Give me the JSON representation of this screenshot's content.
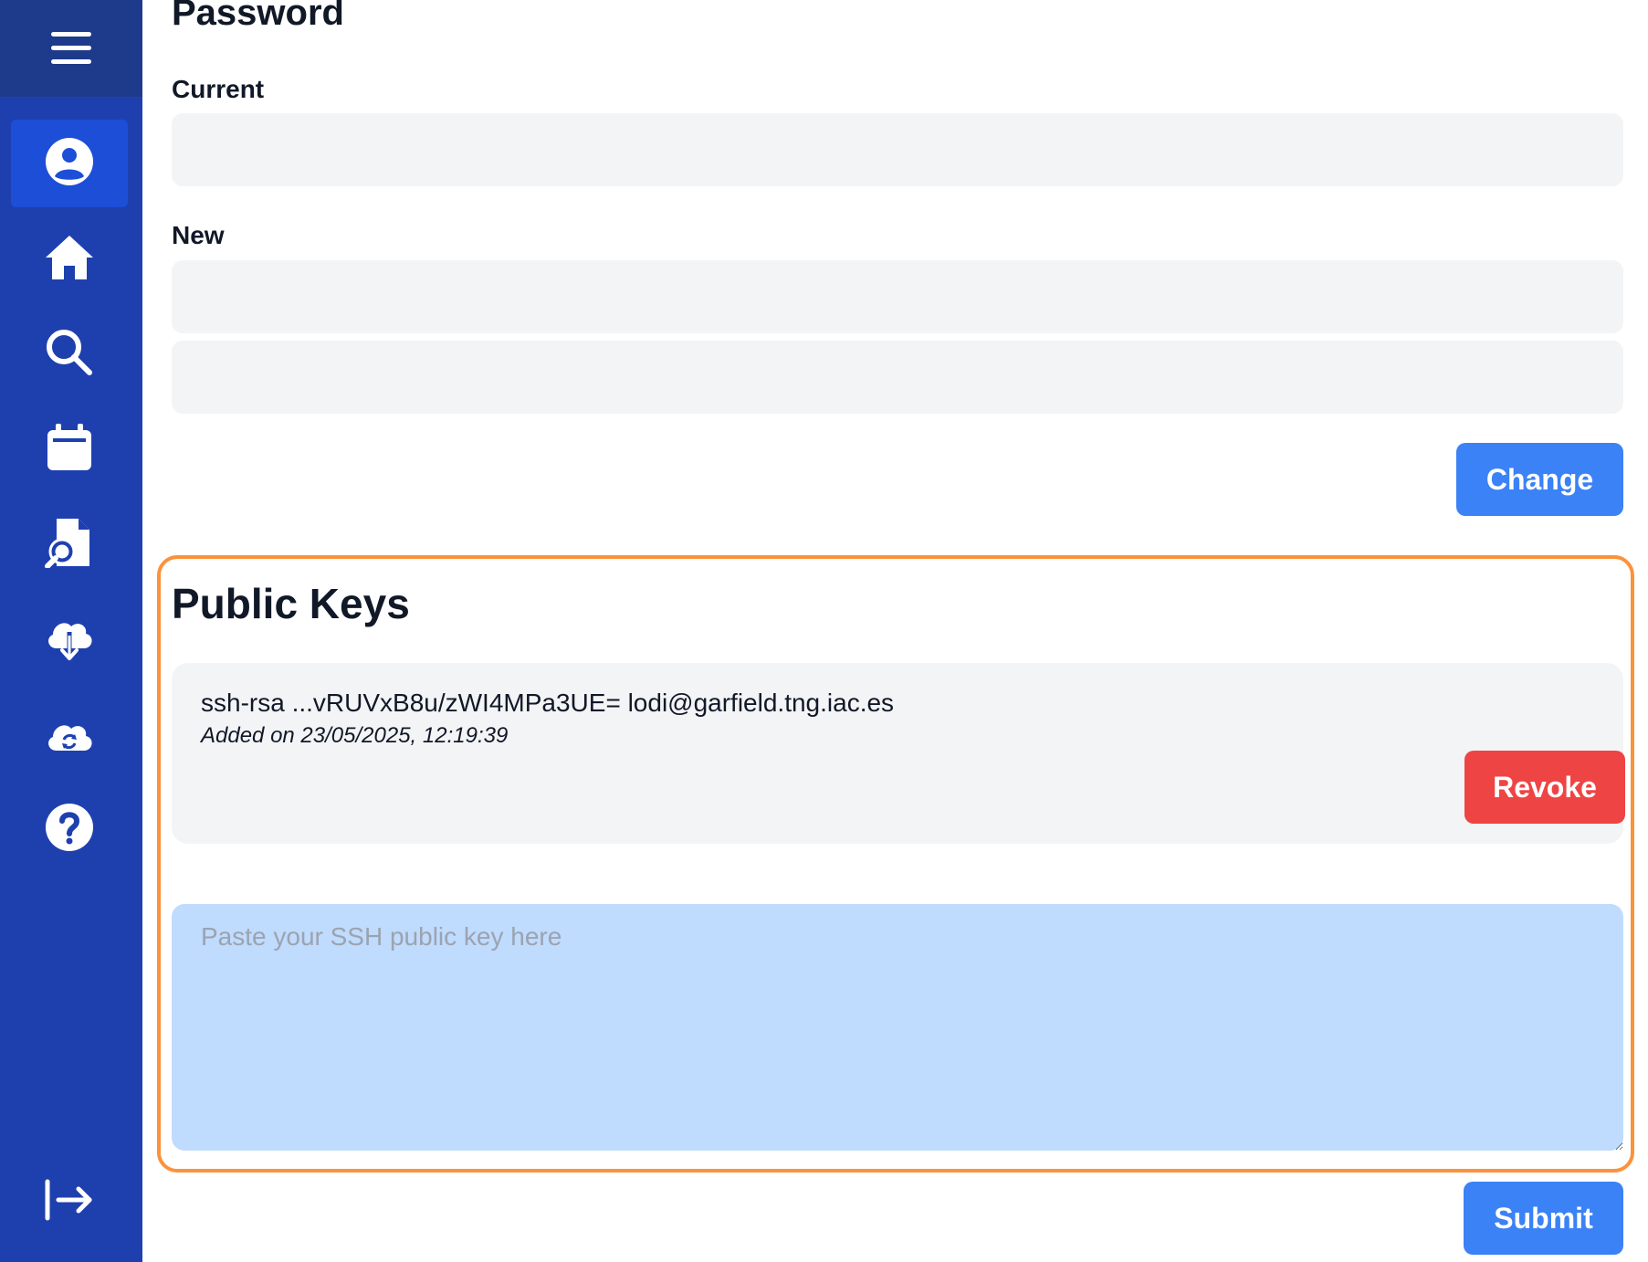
{
  "sidebar": {
    "menu_icon": "hamburger-menu-icon",
    "items": [
      {
        "name": "profile",
        "icon": "user-circle-icon",
        "active": true
      },
      {
        "name": "home",
        "icon": "home-icon",
        "active": false
      },
      {
        "name": "search",
        "icon": "search-icon",
        "active": false
      },
      {
        "name": "calendar",
        "icon": "calendar-icon",
        "active": false
      },
      {
        "name": "file-search",
        "icon": "file-search-icon",
        "active": false
      },
      {
        "name": "cloud-download",
        "icon": "cloud-download-icon",
        "active": false
      },
      {
        "name": "cloud-sync",
        "icon": "cloud-sync-icon",
        "active": false
      },
      {
        "name": "help",
        "icon": "help-circle-icon",
        "active": false
      }
    ],
    "logout_icon": "logout-icon",
    "background_color": "#1e40af",
    "active_color": "#1d4ed8"
  },
  "password": {
    "heading": "Password",
    "current_label": "Current",
    "current_value": "",
    "new_label": "New",
    "new_value": "",
    "confirm_value": "",
    "change_button": "Change"
  },
  "public_keys": {
    "heading": "Public Keys",
    "keys": [
      {
        "key": "ssh-rsa ...vRUVxB8u/zWI4MPa3UE= lodi@garfield.tng.iac.es",
        "added": "Added on 23/05/2025, 12:19:39",
        "revoke_button": "Revoke"
      }
    ],
    "textarea_placeholder": "Paste your SSH public key here",
    "textarea_value": "",
    "highlight_color": "#fb923c"
  },
  "submit_button": "Submit",
  "colors": {
    "primary": "#3b82f6",
    "danger": "#ef4444",
    "input_bg": "#f3f4f6",
    "textarea_bg": "#bfdbfe"
  }
}
